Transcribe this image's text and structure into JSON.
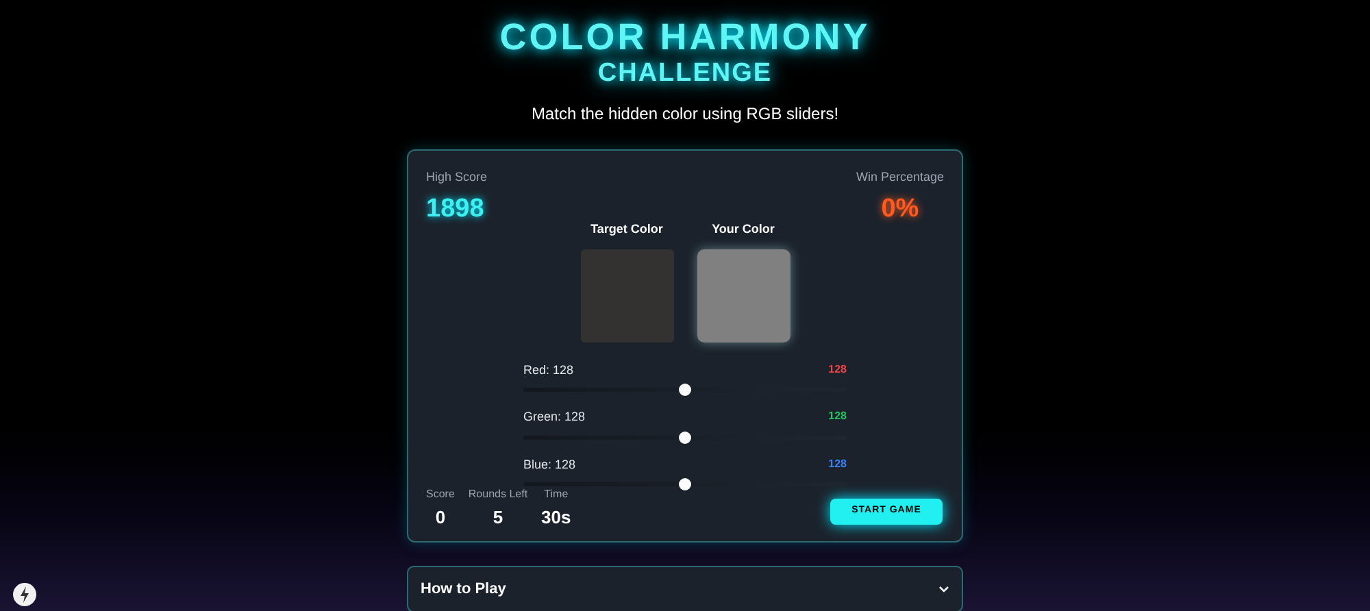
{
  "header": {
    "title": "COLOR HARMONY",
    "subtitle": "CHALLENGE",
    "tagline": "Match the hidden color using RGB sliders!"
  },
  "stats": {
    "high_score": {
      "label": "High Score",
      "value": "1898"
    },
    "win_percentage": {
      "label": "Win Percentage",
      "value": "0%"
    }
  },
  "swatches": [
    {
      "label": "Target Color",
      "color": "#333230"
    },
    {
      "label": "Your Color",
      "color": "#808080"
    }
  ],
  "sliders": [
    {
      "label": "Red: 128",
      "level": 0.5,
      "reading": "128",
      "color": "#ef4444"
    },
    {
      "label": "Green: 128",
      "level": 0.5,
      "reading": "128",
      "color": "#22c55e"
    },
    {
      "label": "Blue: 128",
      "level": 0.5,
      "reading": "128",
      "color": "#3b82f6"
    }
  ],
  "game_stats": [
    {
      "label": "Score",
      "value": "0"
    },
    {
      "label": "Rounds Left",
      "value": "5"
    },
    {
      "label": "Time",
      "value": "30s"
    }
  ],
  "start_button": "START GAME",
  "how_to_play": {
    "title": "How to Play",
    "expanded": false
  }
}
